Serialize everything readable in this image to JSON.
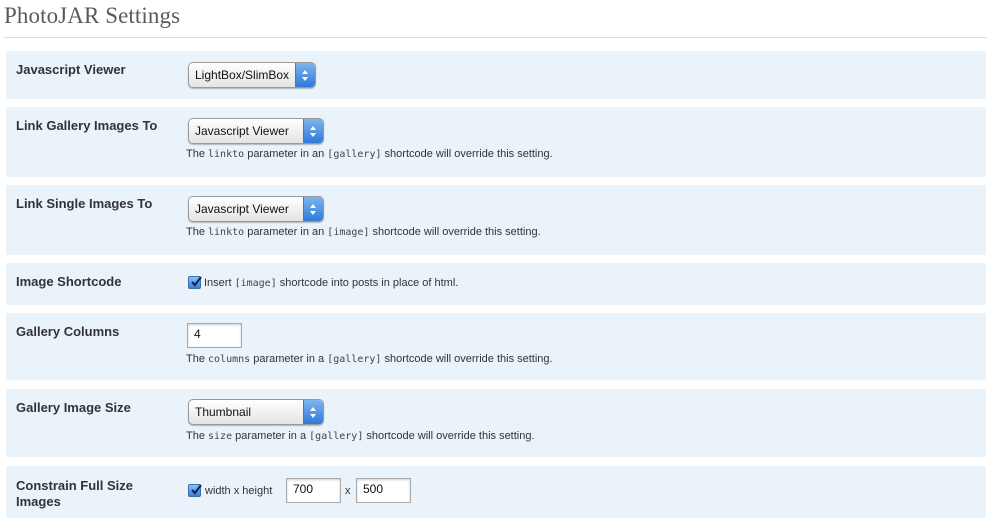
{
  "page": {
    "title": "PhotoJAR Settings"
  },
  "settings": {
    "javascript_viewer": {
      "label": "Javascript Viewer",
      "value": "LightBox/SlimBox"
    },
    "link_gallery": {
      "label": "Link Gallery Images To",
      "value": "Javascript Viewer",
      "desc_pre": "The ",
      "desc_code1": "linkto",
      "desc_mid": " parameter in an ",
      "desc_code2": "[gallery]",
      "desc_post": " shortcode will override this setting."
    },
    "link_single": {
      "label": "Link Single Images To",
      "value": "Javascript Viewer",
      "desc_pre": "The ",
      "desc_code1": "linkto",
      "desc_mid": " parameter in an ",
      "desc_code2": "[image]",
      "desc_post": " shortcode will override this setting."
    },
    "image_shortcode": {
      "label": "Image Shortcode",
      "checked": true,
      "text_pre": "Insert ",
      "text_code": "[image]",
      "text_post": " shortcode into posts in place of html."
    },
    "gallery_columns": {
      "label": "Gallery Columns",
      "value": "4",
      "desc_pre": "The ",
      "desc_code1": "columns",
      "desc_mid": " parameter in a ",
      "desc_code2": "[gallery]",
      "desc_post": " shortcode will override this setting."
    },
    "gallery_image_size": {
      "label": "Gallery Image Size",
      "value": "Thumbnail",
      "desc_pre": "The ",
      "desc_code1": "size",
      "desc_mid": " parameter in a ",
      "desc_code2": "[gallery]",
      "desc_post": " shortcode will override this setting."
    },
    "constrain_full_size": {
      "label": "Constrain Full Size Images",
      "checked": true,
      "text": "width x height",
      "width_value": "700",
      "separator": "x",
      "height_value": "500"
    }
  },
  "icons": {
    "select_arrows": "updown-arrows-icon",
    "check": "checkmark-icon"
  },
  "colors": {
    "row_bg": "#eaf2fa",
    "accent": "#3b80d8"
  }
}
